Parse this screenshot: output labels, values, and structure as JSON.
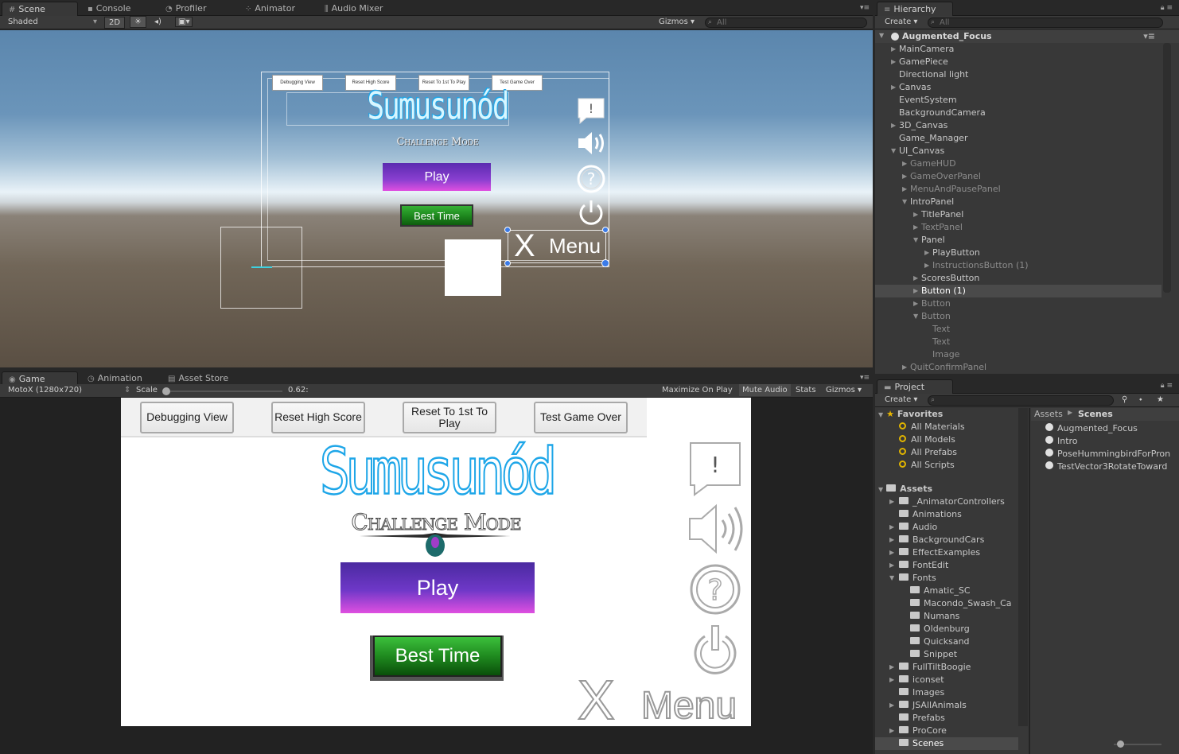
{
  "scene_panel": {
    "tabs": [
      {
        "label": "Scene",
        "icon": "grid-icon"
      },
      {
        "label": "Console",
        "icon": "console-icon"
      },
      {
        "label": "Profiler",
        "icon": "profiler-icon"
      },
      {
        "label": "Animator",
        "icon": "animator-icon"
      },
      {
        "label": "Audio Mixer",
        "icon": "audio-mixer-icon"
      }
    ],
    "shading_mode": "Shaded",
    "mode_2d": "2D",
    "gizmos_label": "Gizmos",
    "search_placeholder": "All"
  },
  "scene_ui": {
    "debug_buttons": [
      "Debugging View",
      "Reset High Score",
      "Reset To 1st To Play",
      "Test Game Over"
    ],
    "title": "Sumusunód",
    "subtitle": "Challenge Mode",
    "play_label": "Play",
    "best_time_label": "Best Time",
    "menu_x": "X",
    "menu_label": "Menu"
  },
  "hierarchy": {
    "tab_label": "Hierarchy",
    "create_label": "Create",
    "search_placeholder": "All",
    "scene_name": "Augmented_Focus",
    "rows": [
      {
        "label": "MainCamera",
        "depth": 0,
        "arrow": "right",
        "dim": false
      },
      {
        "label": "GamePiece",
        "depth": 0,
        "arrow": "right",
        "dim": false
      },
      {
        "label": "Directional light",
        "depth": 0,
        "arrow": "",
        "dim": false
      },
      {
        "label": "Canvas",
        "depth": 0,
        "arrow": "right",
        "dim": false
      },
      {
        "label": "EventSystem",
        "depth": 0,
        "arrow": "",
        "dim": false
      },
      {
        "label": "BackgroundCamera",
        "depth": 0,
        "arrow": "",
        "dim": false
      },
      {
        "label": "3D_Canvas",
        "depth": 0,
        "arrow": "right",
        "dim": false
      },
      {
        "label": "Game_Manager",
        "depth": 0,
        "arrow": "",
        "dim": false
      },
      {
        "label": "UI_Canvas",
        "depth": 0,
        "arrow": "down",
        "dim": false
      },
      {
        "label": "GameHUD",
        "depth": 1,
        "arrow": "right",
        "dim": true
      },
      {
        "label": "GameOverPanel",
        "depth": 1,
        "arrow": "right",
        "dim": true
      },
      {
        "label": "MenuAndPausePanel",
        "depth": 1,
        "arrow": "right",
        "dim": true
      },
      {
        "label": "IntroPanel",
        "depth": 1,
        "arrow": "down",
        "dim": false
      },
      {
        "label": "TitlePanel",
        "depth": 2,
        "arrow": "right",
        "dim": false
      },
      {
        "label": "TextPanel",
        "depth": 2,
        "arrow": "right",
        "dim": true
      },
      {
        "label": "Panel",
        "depth": 2,
        "arrow": "down",
        "dim": false
      },
      {
        "label": "PlayButton",
        "depth": 3,
        "arrow": "right",
        "dim": false
      },
      {
        "label": "InstructionsButton (1)",
        "depth": 3,
        "arrow": "right",
        "dim": true
      },
      {
        "label": "ScoresButton",
        "depth": 2,
        "arrow": "right",
        "dim": false
      },
      {
        "label": "Button (1)",
        "depth": 2,
        "arrow": "right",
        "dim": false,
        "selected": true
      },
      {
        "label": "Button",
        "depth": 2,
        "arrow": "right",
        "dim": true
      },
      {
        "label": "Button",
        "depth": 2,
        "arrow": "down",
        "dim": true
      },
      {
        "label": "Text",
        "depth": 3,
        "arrow": "",
        "dim": true
      },
      {
        "label": "Text",
        "depth": 3,
        "arrow": "",
        "dim": true
      },
      {
        "label": "Image",
        "depth": 3,
        "arrow": "",
        "dim": true
      },
      {
        "label": "QuitConfirmPanel",
        "depth": 1,
        "arrow": "right",
        "dim": true
      }
    ]
  },
  "game_panel": {
    "tabs": [
      {
        "label": "Game",
        "icon": "game-icon"
      },
      {
        "label": "Animation",
        "icon": "animation-icon"
      },
      {
        "label": "Asset Store",
        "icon": "asset-store-icon"
      }
    ],
    "resolution": "MotoX (1280x720)",
    "scale_label": "Scale",
    "scale_value": "0.62:",
    "scale_fraction": 0.0,
    "maximize_label": "Maximize On Play",
    "mute_label": "Mute Audio",
    "stats_label": "Stats",
    "gizmos_label": "Gizmos"
  },
  "game_ui": {
    "debug_buttons": [
      "Debugging View",
      "Reset High Score",
      "Reset To 1st To Play",
      "Test Game Over"
    ],
    "title": "Sumusunód",
    "subtitle": "Challenge Mode",
    "play_label": "Play",
    "best_time_label": "Best Time",
    "menu_x": "X",
    "menu_label": "Menu"
  },
  "project": {
    "tab_label": "Project",
    "create_label": "Create",
    "favorites_label": "Favorites",
    "favorites": [
      "All Materials",
      "All Models",
      "All Prefabs",
      "All Scripts"
    ],
    "assets_label": "Assets",
    "asset_folders": [
      {
        "label": "_AnimatorControllers",
        "depth": 0,
        "arrow": "right"
      },
      {
        "label": "Animations",
        "depth": 0,
        "arrow": ""
      },
      {
        "label": "Audio",
        "depth": 0,
        "arrow": "right"
      },
      {
        "label": "BackgroundCars",
        "depth": 0,
        "arrow": "right"
      },
      {
        "label": "EffectExamples",
        "depth": 0,
        "arrow": "right"
      },
      {
        "label": "FontEdit",
        "depth": 0,
        "arrow": "right"
      },
      {
        "label": "Fonts",
        "depth": 0,
        "arrow": "down"
      },
      {
        "label": "Amatic_SC",
        "depth": 1,
        "arrow": ""
      },
      {
        "label": "Macondo_Swash_Ca",
        "depth": 1,
        "arrow": ""
      },
      {
        "label": "Numans",
        "depth": 1,
        "arrow": ""
      },
      {
        "label": "Oldenburg",
        "depth": 1,
        "arrow": ""
      },
      {
        "label": "Quicksand",
        "depth": 1,
        "arrow": ""
      },
      {
        "label": "Snippet",
        "depth": 1,
        "arrow": ""
      },
      {
        "label": "FullTiltBoogie",
        "depth": 0,
        "arrow": "right"
      },
      {
        "label": "iconset",
        "depth": 0,
        "arrow": "right"
      },
      {
        "label": "Images",
        "depth": 0,
        "arrow": ""
      },
      {
        "label": "JSAllAnimals",
        "depth": 0,
        "arrow": "right"
      },
      {
        "label": "Prefabs",
        "depth": 0,
        "arrow": ""
      },
      {
        "label": "ProCore",
        "depth": 0,
        "arrow": "right"
      },
      {
        "label": "Scenes",
        "depth": 0,
        "arrow": "",
        "selected": true
      }
    ],
    "breadcrumb": [
      "Assets",
      "Scenes"
    ],
    "scene_files": [
      "Augmented_Focus",
      "Intro",
      "PoseHummingbirdForPron",
      "TestVector3RotateToward"
    ]
  },
  "colors": {
    "title_blue": "#1ea6e8",
    "play_top": "#5b2bb0",
    "play_bottom": "#e04fe0",
    "best_time_green": "#1f8a1f",
    "selection": "#4a4a4a"
  }
}
